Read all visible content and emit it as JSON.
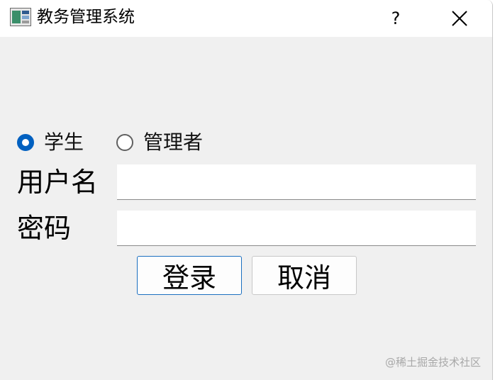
{
  "window": {
    "title": "教务管理系统",
    "help_symbol": "?",
    "icons": {
      "app": "app-window-icon",
      "close": "close-icon"
    }
  },
  "role": {
    "options": [
      {
        "label": "学生",
        "checked": true
      },
      {
        "label": "管理者",
        "checked": false
      }
    ]
  },
  "form": {
    "username_label": "用户名",
    "username_value": "",
    "password_label": "密码",
    "password_value": ""
  },
  "buttons": {
    "login_label": "登录",
    "cancel_label": "取消"
  },
  "watermark": "@稀土掘金技术社区",
  "colors": {
    "accent": "#0060c0",
    "window_bg": "#f0f0f0",
    "titlebar_bg": "#ffffff"
  }
}
